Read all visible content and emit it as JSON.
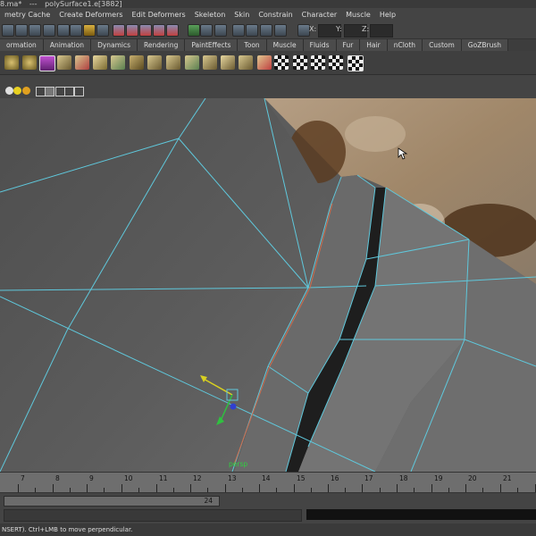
{
  "title": {
    "file": "8.ma*",
    "sep": "---",
    "selection": "polySurface1.e[3882]"
  },
  "menu": [
    "metry Cache",
    "Create Deformers",
    "Edit Deformers",
    "Skeleton",
    "Skin",
    "Constrain",
    "Character",
    "Muscle",
    "Help"
  ],
  "status": {
    "x_label": "X:",
    "y_label": "Y:",
    "z_label": "Z:"
  },
  "shelf_tabs": [
    "ormation",
    "Animation",
    "Dynamics",
    "Rendering",
    "PaintEffects",
    "Toon",
    "Muscle",
    "Fluids",
    "Fur",
    "Hair",
    "nCloth",
    "Custom",
    "GoZBrush"
  ],
  "viewport": {
    "camera_label": "persp"
  },
  "timeline": {
    "ticks": [
      "7",
      "8",
      "9",
      "10",
      "11",
      "12",
      "13",
      "14",
      "15",
      "16",
      "17",
      "18",
      "19",
      "20",
      "21"
    ],
    "range_end": "24"
  },
  "helpline": "NSERT). Ctrl+LMB to move perpendicular."
}
